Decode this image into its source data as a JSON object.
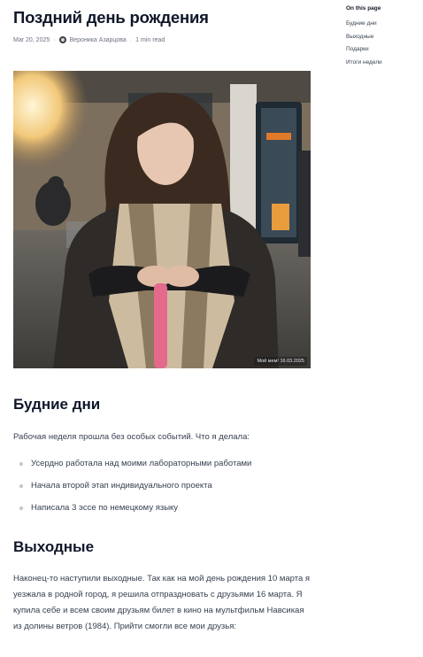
{
  "article": {
    "title": "Поздний день рождения",
    "date": "Mar 20, 2025",
    "author": "Вероника Азарцова",
    "read_time": "1 min read"
  },
  "figure": {
    "caption": "Мой мем! 16.03.2025"
  },
  "sections": [
    {
      "heading": "Будние дни",
      "intro": "Рабочая неделя прошла без особых событий. Что я делала:",
      "items": [
        "Усердно работала над моими лабораторными работами",
        "Начала второй этап индивидуального проекта",
        "Написала 3 эссе по немецкому языку"
      ]
    },
    {
      "heading": "Выходные",
      "paragraph": "Наконец-то наступили выходные. Так как на мой день рождения 10 марта я уезжала в родной город, я решила отпраздновать с друзьями 16 марта. Я купила себе и всем своим друзьям билет в кино на мультфильм Навсикая из долины ветров (1984). Прийти смогли все мои друзья:"
    }
  ],
  "toc": {
    "title": "On this page",
    "items": [
      "Будние дни",
      "Выходные",
      "Подарки",
      "Итоги недели"
    ]
  },
  "colors": {
    "heading": "#0f172a",
    "body_text": "#374151",
    "muted": "#6b7280",
    "bullet": "#c4c8cf"
  }
}
